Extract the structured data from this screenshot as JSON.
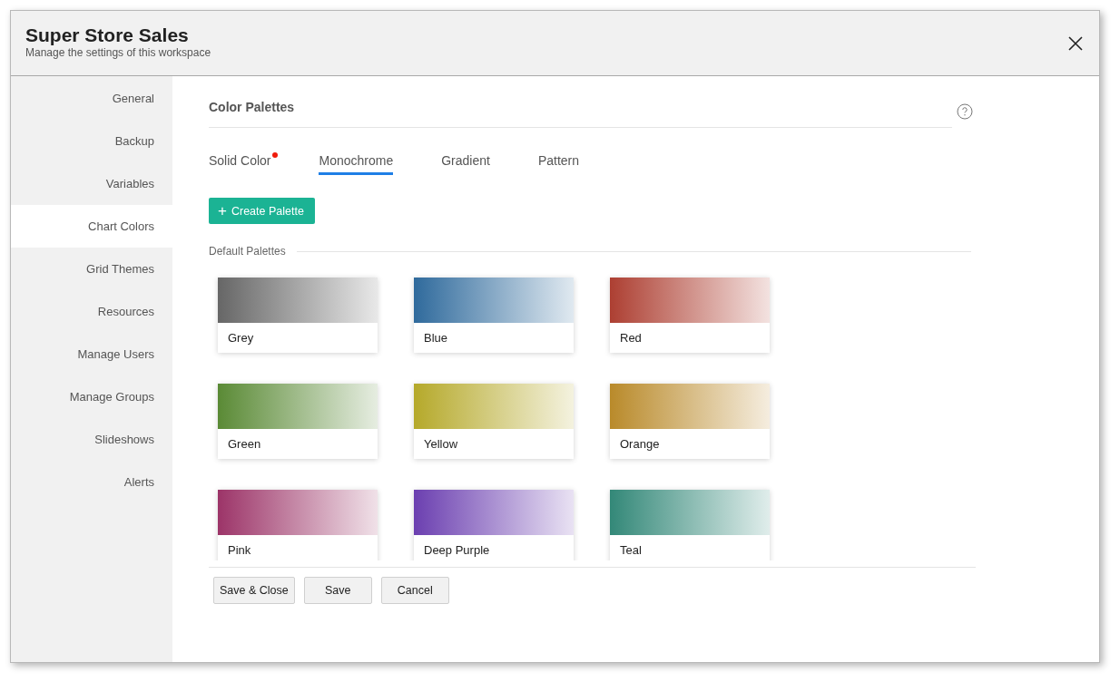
{
  "window": {
    "title": "Super Store Sales",
    "subtitle": "Manage the settings of this workspace"
  },
  "sidebar": {
    "items": [
      {
        "label": "General",
        "selected": false
      },
      {
        "label": "Backup",
        "selected": false
      },
      {
        "label": "Variables",
        "selected": false
      },
      {
        "label": "Chart Colors",
        "selected": true
      },
      {
        "label": "Grid Themes",
        "selected": false
      },
      {
        "label": "Resources",
        "selected": false
      },
      {
        "label": "Manage Users",
        "selected": false
      },
      {
        "label": "Manage Groups",
        "selected": false
      },
      {
        "label": "Slideshows",
        "selected": false
      },
      {
        "label": "Alerts",
        "selected": false
      }
    ]
  },
  "section": {
    "title": "Color Palettes"
  },
  "tabs": [
    {
      "label": "Solid Color",
      "selected": false,
      "notification": true
    },
    {
      "label": "Monochrome",
      "selected": true,
      "notification": false
    },
    {
      "label": "Gradient",
      "selected": false,
      "notification": false
    },
    {
      "label": "Pattern",
      "selected": false,
      "notification": false
    }
  ],
  "create_button": {
    "icon": "+",
    "label": "Create Palette"
  },
  "palette_group": {
    "title": "Default Palettes"
  },
  "palettes": [
    {
      "name": "Grey",
      "color": "#666666"
    },
    {
      "name": "Blue",
      "color": "#2f6a9c"
    },
    {
      "name": "Red",
      "color": "#ad3f32"
    },
    {
      "name": "Green",
      "color": "#5a8a35"
    },
    {
      "name": "Yellow",
      "color": "#b5a92a"
    },
    {
      "name": "Orange",
      "color": "#b98a2a"
    },
    {
      "name": "Pink",
      "color": "#9c3468"
    },
    {
      "name": "Deep Purple",
      "color": "#6b3fb0"
    },
    {
      "name": "Teal",
      "color": "#338878"
    }
  ],
  "footer_buttons": [
    "Save & Close",
    "Save",
    "Cancel"
  ]
}
